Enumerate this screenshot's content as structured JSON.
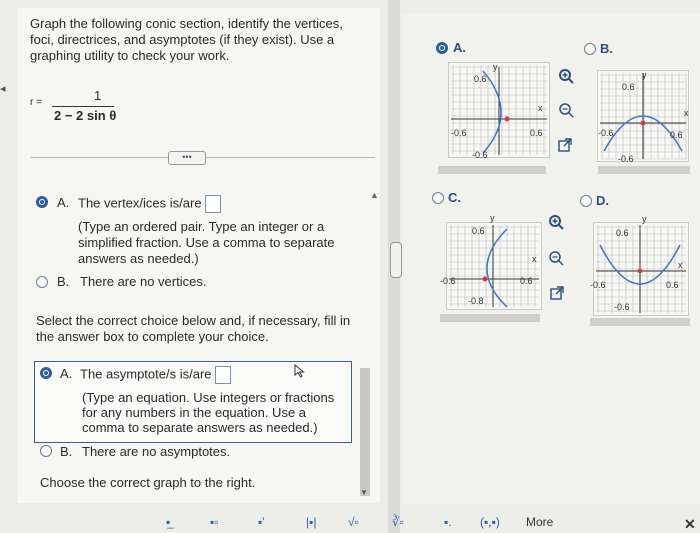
{
  "instructions": {
    "line1": "Graph the following conic section, identify the vertices,",
    "line2": "foci, directrices, and asymptotes (if they exist). Use a",
    "line3": "graphing utility to check your work."
  },
  "equation": {
    "lhs": "r =",
    "numerator": "1",
    "denominator": "2 − 2 sin θ"
  },
  "ellipsis": "•••",
  "vertex": {
    "option_a_letter": "A.",
    "option_a_text": "The vertex/ices is/are",
    "hint1": "(Type an ordered pair. Type an integer or a",
    "hint2": "simplified fraction. Use a comma to separate",
    "hint3": "answers as needed.)",
    "option_b_letter": "B.",
    "option_b_text": "There are no vertices."
  },
  "asym_prompt": {
    "line1": "Select the correct choice below and, if necessary, fill in",
    "line2": "the answer box to complete your choice."
  },
  "asymptote": {
    "option_a_letter": "A.",
    "option_a_text": "The asymptote/s is/are",
    "hint1": "(Type an equation. Use integers or fractions",
    "hint2": "for any numbers in the equation. Use a",
    "hint3": "comma to separate answers as needed.)",
    "option_b_letter": "B.",
    "option_b_text": "There are no asymptotes."
  },
  "graph_prompt": "Choose the correct graph to the right.",
  "graph_options": {
    "a": {
      "letter": "A.",
      "y": "y",
      "x": "x",
      "top": "0.6",
      "bottom": "-0.6",
      "left": "-0.6",
      "right": "0.6"
    },
    "b": {
      "letter": "B.",
      "y": "y",
      "x": "x",
      "top": "0.6",
      "bottom": "-0.6",
      "left": "-0.6",
      "right": "0.6"
    },
    "c": {
      "letter": "C.",
      "y": "y",
      "x": "x",
      "top": "0.6",
      "bottom": "-0.8",
      "left": "-0.6",
      "right": "0.6"
    },
    "d": {
      "letter": "D.",
      "y": "y",
      "x": "x",
      "top": "0.6",
      "bottom": "-0.6",
      "left": "-0.6",
      "right": "0.6"
    }
  },
  "toolbar": {
    "more": "More"
  },
  "close_glyph": "✕",
  "colors": {
    "accent": "#2b5f9e",
    "curve": "#3a78c2",
    "point": "#d23c3c"
  }
}
